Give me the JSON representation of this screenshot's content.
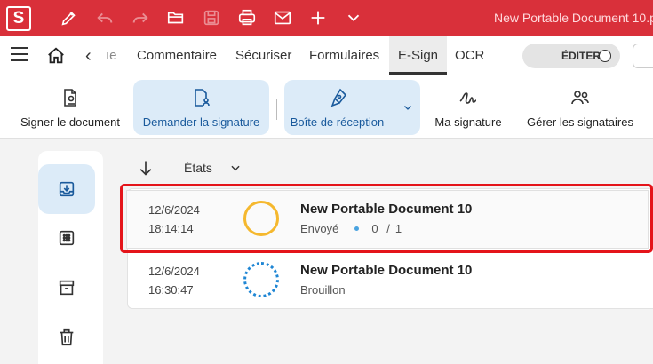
{
  "titlebar": {
    "app_letter": "S",
    "document_title": "New Portable Document 10.p"
  },
  "menu": {
    "partial_tab": "ıe",
    "tabs": [
      {
        "label": "Commentaire"
      },
      {
        "label": "Sécuriser"
      },
      {
        "label": "Formulaires"
      },
      {
        "label": "E-Sign"
      },
      {
        "label": "OCR"
      }
    ],
    "edit_toggle_label": "ÉDITER"
  },
  "ribbon": {
    "sign_document": "Signer le document",
    "request_signature": "Demander la signature",
    "inbox": "Boîte de réception",
    "my_signature": "Ma signature",
    "manage_signers": "Gérer les signataires"
  },
  "filter": {
    "label": "États"
  },
  "documents": [
    {
      "date": "12/6/2024",
      "time": "18:14:14",
      "name": "New Portable Document 10",
      "status": "Envoyé",
      "signed": "0",
      "sep": "/",
      "total": "1",
      "status_color": "#f5b82e"
    },
    {
      "date": "12/6/2024",
      "time": "16:30:47",
      "name": "New Portable Document 10",
      "status": "Brouillon",
      "status_color": "#1f86d4"
    }
  ],
  "colors": {
    "brand": "#d9303a",
    "accent": "#1a5a9c",
    "highlight": "#e4141a"
  }
}
